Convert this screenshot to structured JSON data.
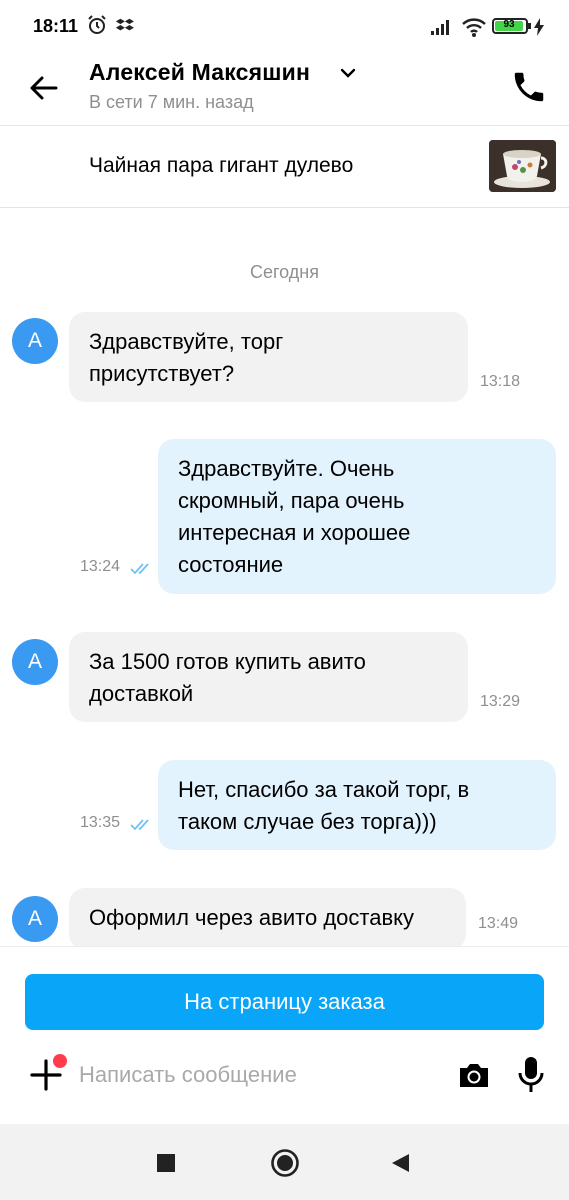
{
  "status_bar": {
    "time": "18:11",
    "battery_level": "93",
    "icons": [
      "alarm-icon",
      "dropbox-icon",
      "signal-icon",
      "wifi-icon",
      "battery-icon",
      "charging-icon"
    ]
  },
  "header": {
    "contact_name": "Алексей Максяшин",
    "status": "В сети 7 мин. назад",
    "icons": [
      "back-arrow-icon",
      "chevron-down-icon",
      "phone-icon"
    ]
  },
  "listing": {
    "title": "Чайная пара гигант дулево"
  },
  "chat": {
    "date_label": "Сегодня",
    "avatar_letter": "А",
    "messages": [
      {
        "direction": "in",
        "lines": [
          "Здравствуйте, торг",
          "присутствует?"
        ],
        "time": "13:18"
      },
      {
        "direction": "out",
        "lines": [
          "Здравствуйте. Очень",
          "скромный, пара очень",
          "интересная и хорошее",
          "состояние"
        ],
        "time": "13:24",
        "read": true
      },
      {
        "direction": "in",
        "lines": [
          "За 1500 готов купить авито",
          "доставкой"
        ],
        "time": "13:29"
      },
      {
        "direction": "out",
        "lines": [
          "Нет, спасибо за такой торг, в",
          "таком случае без торга)))"
        ],
        "time": "13:35",
        "read": true
      },
      {
        "direction": "in",
        "lines": [
          "Оформил через авито доставку"
        ],
        "time": "13:49"
      }
    ]
  },
  "bottom": {
    "order_button": "На страницу заказа",
    "input_placeholder": "Написать сообщение",
    "icons": [
      "plus-icon",
      "camera-icon",
      "microphone-icon"
    ]
  },
  "colors": {
    "accent": "#08a5f8",
    "avatar": "#3a99f0",
    "incoming_bubble": "#f2f2f2",
    "outgoing_bubble": "#e3f3fd",
    "read_ticks": "#6ec3f2",
    "notification_dot": "#ff3b4c"
  }
}
